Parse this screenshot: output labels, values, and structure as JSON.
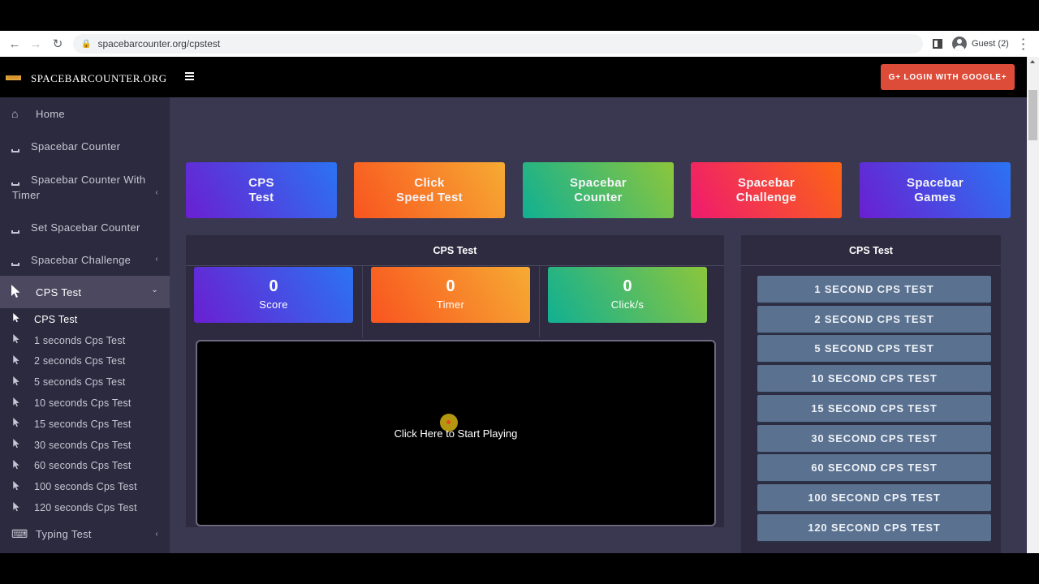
{
  "browser": {
    "url": "spacebarcounter.org/cpstest",
    "profile_label": "Guest (2)"
  },
  "header": {
    "brand": "SPACEBARCOUNTER.ORG",
    "login_button": "G+ LOGIN WITH GOOGLE+"
  },
  "sidebar": {
    "items": [
      {
        "label": "Home",
        "icon": "home-icon"
      },
      {
        "label": "Spacebar Counter",
        "icon": "space-icon"
      },
      {
        "label": "Spacebar Counter With Timer",
        "icon": "space-icon",
        "chevron": "‹"
      },
      {
        "label": "Set Spacebar Counter",
        "icon": "space-icon"
      },
      {
        "label": "Spacebar Challenge",
        "icon": "space-icon",
        "chevron": "‹"
      },
      {
        "label": "CPS Test",
        "icon": "cursor-icon",
        "chevron": "⌄",
        "active": true
      }
    ],
    "sub_items": [
      {
        "label": "CPS Test"
      },
      {
        "label": "1 seconds Cps Test"
      },
      {
        "label": "2 seconds Cps Test"
      },
      {
        "label": "5 seconds Cps Test"
      },
      {
        "label": "10 seconds Cps Test"
      },
      {
        "label": "15 seconds Cps Test"
      },
      {
        "label": "30 seconds Cps Test"
      },
      {
        "label": "60 seconds Cps Test"
      },
      {
        "label": "100 seconds Cps Test"
      },
      {
        "label": "120 seconds Cps Test"
      }
    ],
    "bottom_item": {
      "label": "Typing Test",
      "icon": "keyboard-icon",
      "chevron": "‹"
    }
  },
  "nav_cards": [
    {
      "label": "CPS\nTest",
      "from": "#6a1fd1",
      "to": "#2b73f2"
    },
    {
      "label": "Click\nSpeed Test",
      "from": "#f9541f",
      "to": "#f6ab33"
    },
    {
      "label": "Spacebar\nCounter",
      "from": "#11b092",
      "to": "#8cc63c"
    },
    {
      "label": "Spacebar\nChallenge",
      "from": "#ef1a6f",
      "to": "#fb6515"
    },
    {
      "label": "Spacebar\nGames",
      "from": "#6a1fd1",
      "to": "#2b73f2"
    }
  ],
  "cps_panel": {
    "title": "CPS Test",
    "stats": [
      {
        "value": "0",
        "label": "Score",
        "from": "#6a1fd1",
        "to": "#2b73f2"
      },
      {
        "value": "0",
        "label": "Timer",
        "from": "#f9541f",
        "to": "#f6ab33"
      },
      {
        "value": "0",
        "label": "Click/s",
        "from": "#11b092",
        "to": "#8cc63c"
      }
    ],
    "game_prompt": "Click Here to Start Playing"
  },
  "side_panel": {
    "title": "CPS Test",
    "buttons": [
      "1 SECOND CPS TEST",
      "2 SECOND CPS TEST",
      "5 SECOND CPS TEST",
      "10 SECOND CPS TEST",
      "15 SECOND CPS TEST",
      "30 SECOND CPS TEST",
      "60 SECOND CPS TEST",
      "100 SECOND CPS TEST",
      "120 SECOND CPS TEST"
    ]
  }
}
